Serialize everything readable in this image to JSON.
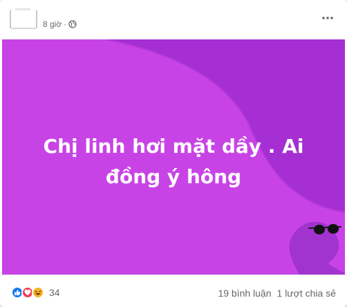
{
  "post": {
    "time": "8 giờ",
    "separator": "·",
    "privacy_icon": "globe-icon",
    "more_icon": "more-horizontal-icon",
    "text": "Chị linh hơi mặt dầy . Ai đồng ý hông",
    "background": {
      "base_color": "#c843e6",
      "shape_color": "#a52fd3"
    }
  },
  "reactions": {
    "icons": [
      "like-icon",
      "love-icon",
      "haha-icon"
    ],
    "count": "34"
  },
  "stats": {
    "comments": "19 bình luận",
    "shares": "1 lượt chia sẻ"
  }
}
